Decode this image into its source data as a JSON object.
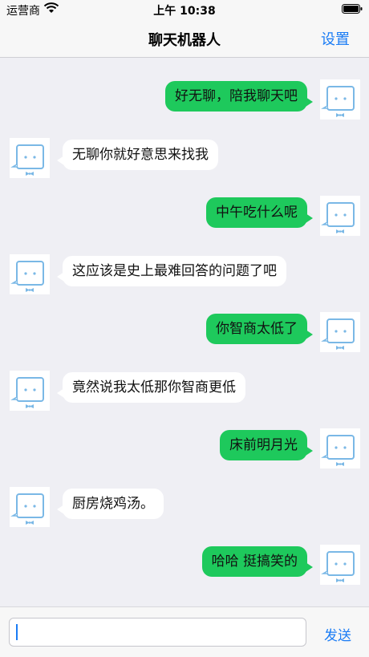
{
  "status_bar": {
    "carrier": "运营商",
    "time": "上午 10:38"
  },
  "nav": {
    "title": "聊天机器人",
    "settings_label": "设置"
  },
  "messages": [
    {
      "side": "out",
      "text": "好无聊，陪我聊天吧"
    },
    {
      "side": "in",
      "text": "无聊你就好意思来找我"
    },
    {
      "side": "out",
      "text": "中午吃什么呢"
    },
    {
      "side": "in",
      "text": "这应该是史上最难回答的问题了吧"
    },
    {
      "side": "out",
      "text": "你智商太低了"
    },
    {
      "side": "in",
      "text": "竟然说我太低那你智商更低"
    },
    {
      "side": "out",
      "text": "床前明月光"
    },
    {
      "side": "in",
      "text": "厨房烧鸡汤。"
    },
    {
      "side": "out",
      "text": "哈哈 挺搞笑的"
    }
  ],
  "input": {
    "value": "",
    "send_label": "发送"
  },
  "colors": {
    "accent": "#1a7cf5",
    "outgoing_bubble": "#1ec95c",
    "incoming_bubble": "#ffffff",
    "avatar_stroke": "#7ab8e6"
  },
  "icons": {
    "avatar": "robot-avatar-icon",
    "wifi": "wifi-icon",
    "battery": "battery-icon"
  }
}
